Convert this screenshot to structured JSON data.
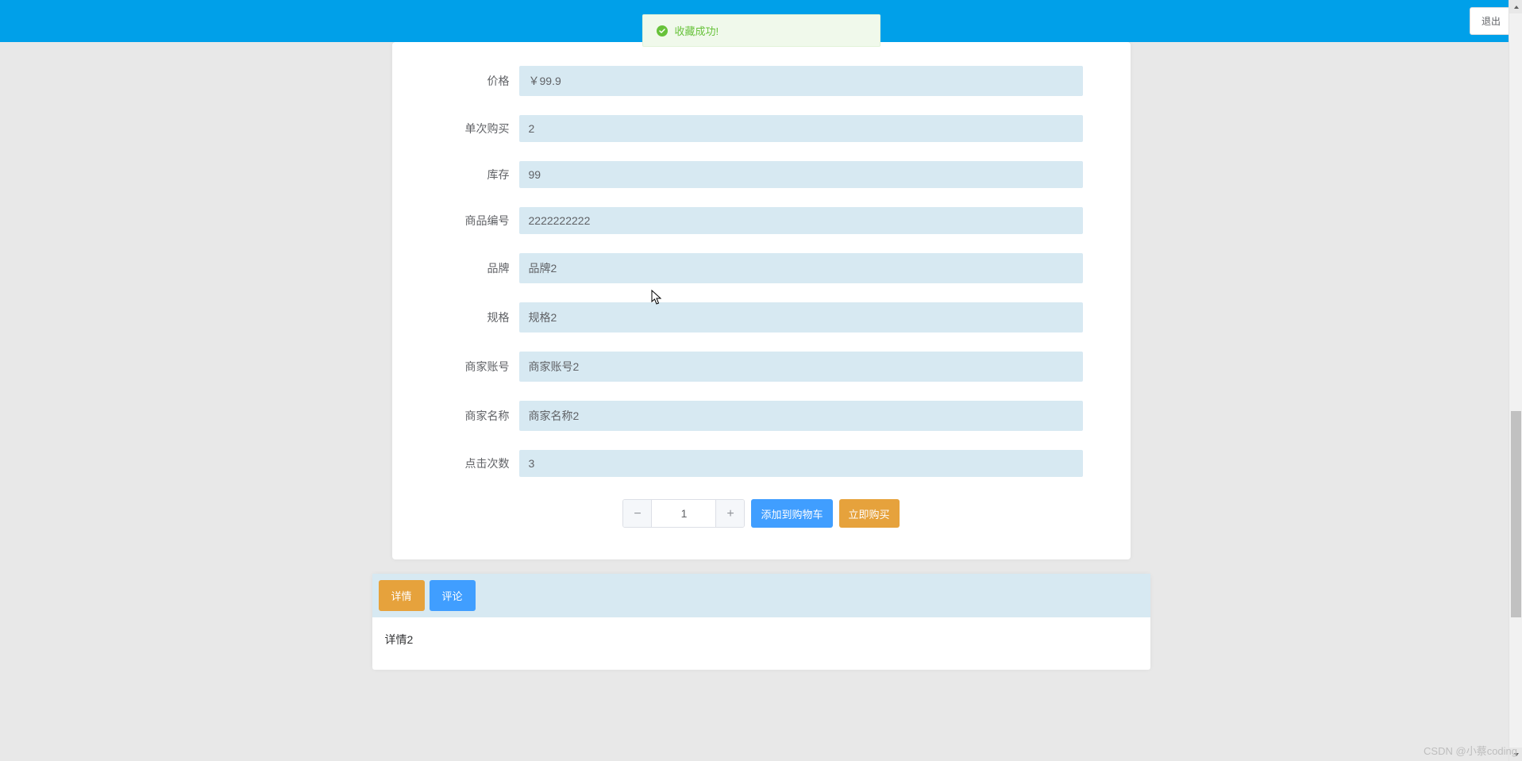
{
  "header": {
    "logout_label": "退出"
  },
  "toast": {
    "message": "收藏成功!"
  },
  "form": {
    "rows": [
      {
        "label": "价格",
        "value": "￥99.9"
      },
      {
        "label": "单次购买",
        "value": "2"
      },
      {
        "label": "库存",
        "value": "99"
      },
      {
        "label": "商品编号",
        "value": "2222222222"
      },
      {
        "label": "品牌",
        "value": "品牌2"
      },
      {
        "label": "规格",
        "value": "规格2"
      },
      {
        "label": "商家账号",
        "value": "商家账号2"
      },
      {
        "label": "商家名称",
        "value": "商家名称2"
      },
      {
        "label": "点击次数",
        "value": "3"
      }
    ]
  },
  "actions": {
    "quantity": "1",
    "add_cart_label": "添加到购物车",
    "buy_now_label": "立即购买"
  },
  "tabs": {
    "detail_label": "详情",
    "comment_label": "评论",
    "detail_content": "详情2"
  },
  "watermark": "CSDN @小蔡coding"
}
